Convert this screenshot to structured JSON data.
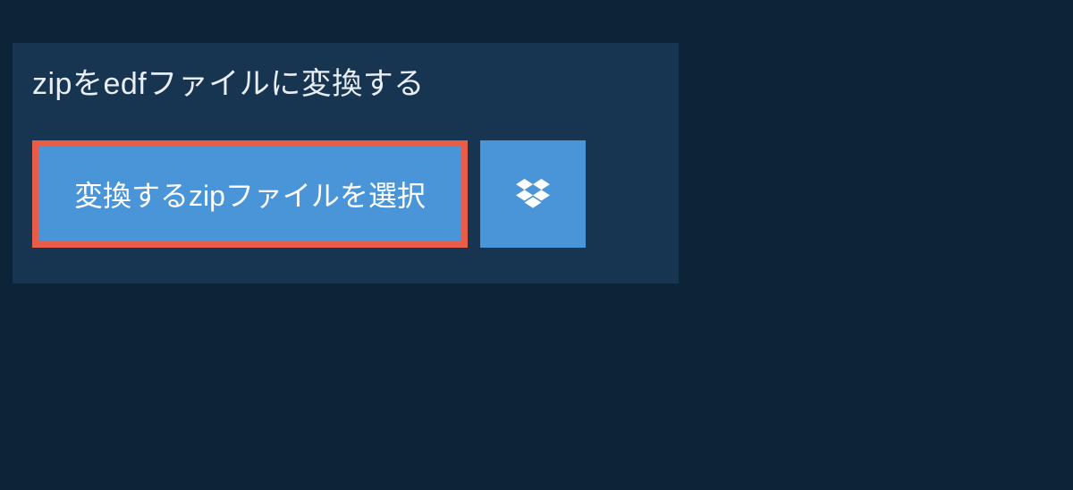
{
  "title": "zipをedfファイルに変換する",
  "select_button_label": "変換するzipファイルを選択",
  "icons": {
    "dropbox": "dropbox-icon"
  }
}
